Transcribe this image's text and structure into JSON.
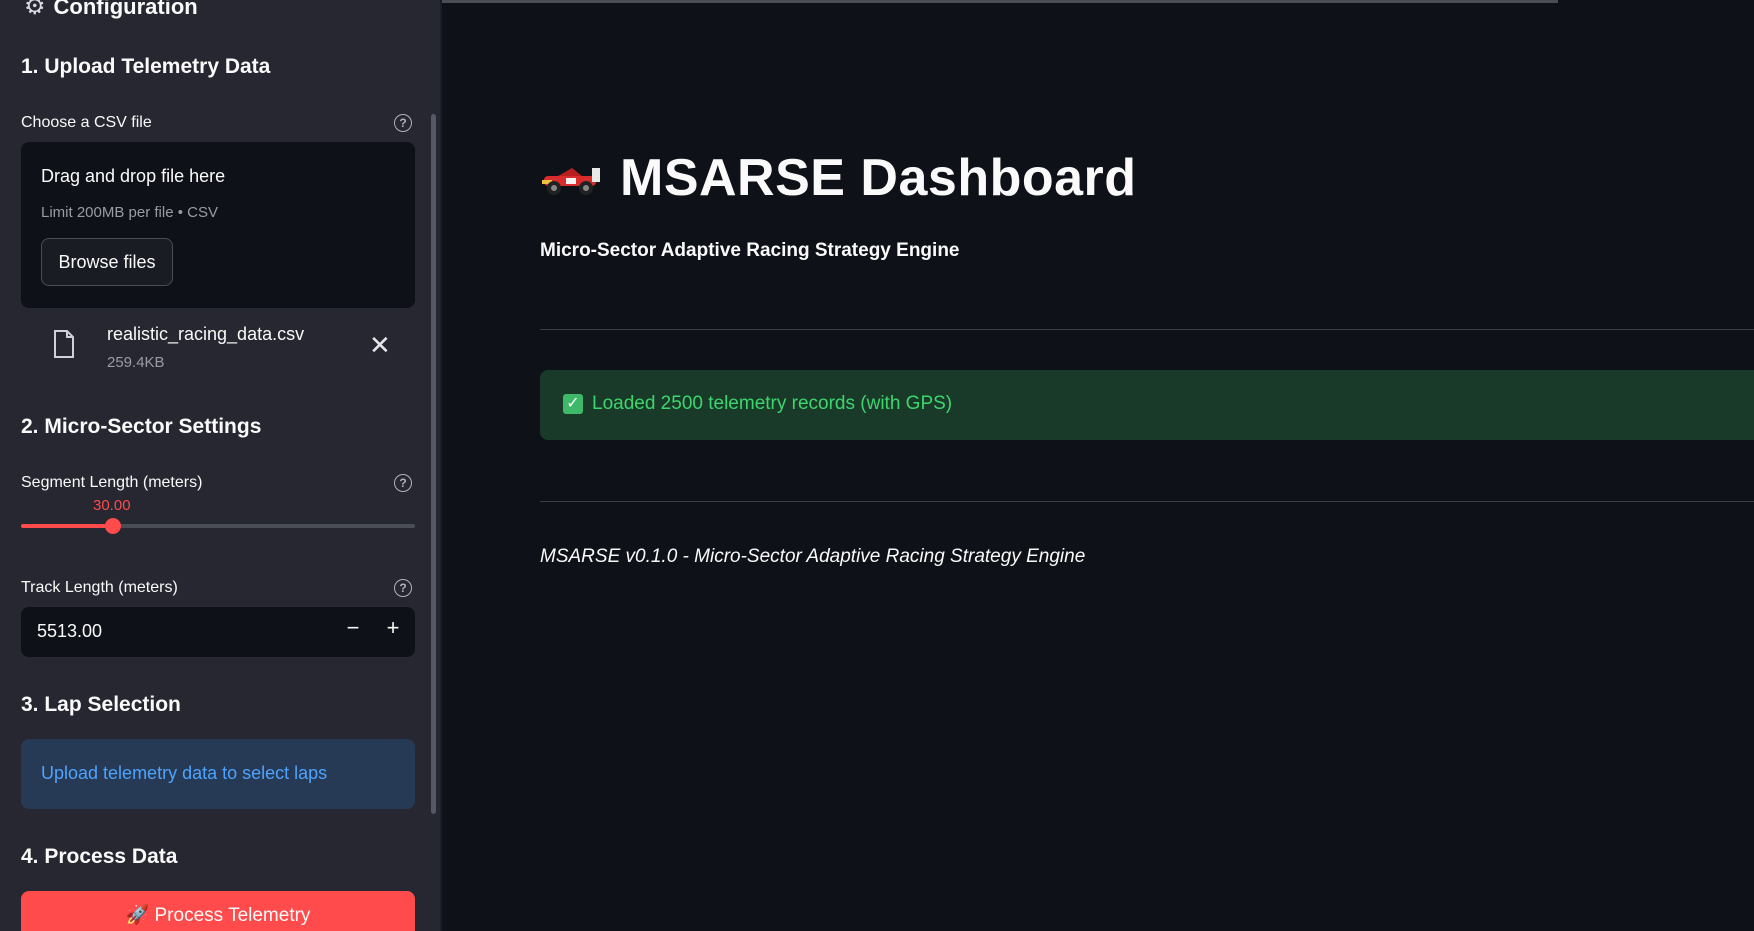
{
  "sidebar": {
    "header": "Configuration",
    "upload": {
      "heading": "1. Upload Telemetry Data",
      "label": "Choose a CSV file",
      "dropzone_title": "Drag and drop file here",
      "dropzone_sub": "Limit 200MB per file • CSV",
      "browse_label": "Browse files",
      "file": {
        "name": "realistic_racing_data.csv",
        "size": "259.4KB"
      }
    },
    "micro_sector": {
      "heading": "2. Micro-Sector Settings",
      "segment_label": "Segment Length (meters)",
      "segment_value": "30.00",
      "segment_fraction": 0.233,
      "track_label": "Track Length (meters)",
      "track_value": "5513.00",
      "minus": "−",
      "plus": "+"
    },
    "lap": {
      "heading": "3. Lap Selection",
      "info": "Upload telemetry data to select laps"
    },
    "process": {
      "heading": "4. Process Data",
      "button_label": "🚀 Process Telemetry"
    }
  },
  "main": {
    "title": "MSARSE Dashboard",
    "subtitle": "Micro-Sector Adaptive Racing Strategy Engine",
    "success": "Loaded 2500 telemetry records (with GPS)",
    "footer": "MSARSE v0.1.0 - Micro-Sector Adaptive Racing Strategy Engine"
  },
  "colors": {
    "background": "#0e1117",
    "sidebar": "#262730",
    "accent": "#ff4b4b",
    "success_bg": "#1a3a29",
    "success_text": "#3dd56d",
    "info_bg": "#263a55",
    "info_text": "#4da3ff"
  },
  "icons": [
    "gear-icon",
    "help-icon",
    "file-icon",
    "close-icon",
    "race-car-icon",
    "check-icon"
  ]
}
